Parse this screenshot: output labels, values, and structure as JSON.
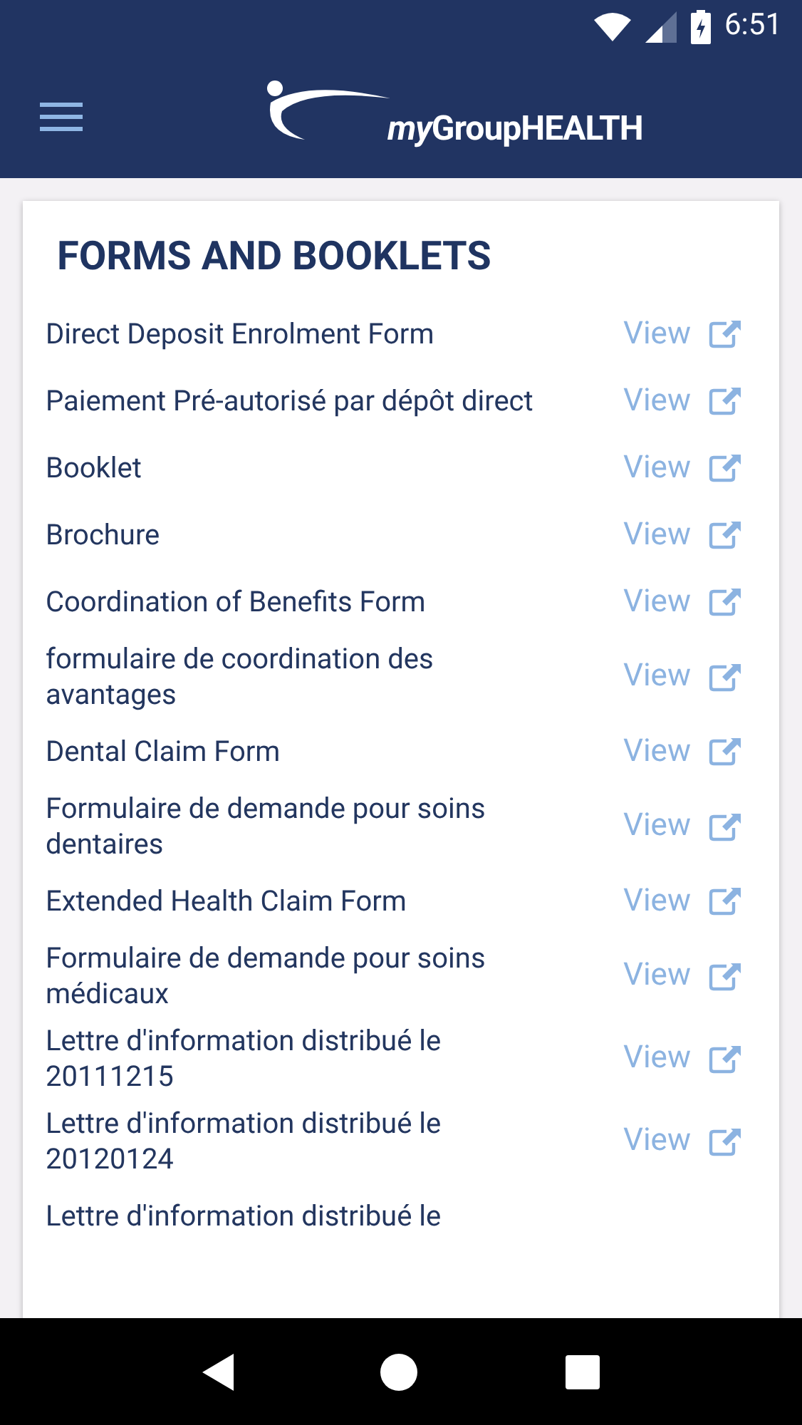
{
  "status_bar": {
    "time": "6:51"
  },
  "app_bar": {
    "logo_prefix": "my",
    "logo_name": "GroupHEALTH"
  },
  "section": {
    "title": "FORMS AND BOOKLETS",
    "items": [
      {
        "title": "Direct Deposit Enrolment Form",
        "link": "View"
      },
      {
        "title": "Paiement Pré-autorisé par dépôt direct",
        "link": "View"
      },
      {
        "title": "Booklet",
        "link": "View"
      },
      {
        "title": "Brochure",
        "link": "View"
      },
      {
        "title": "Coordination of Benefits Form",
        "link": "View"
      },
      {
        "title": "formulaire de coordination des avantages",
        "link": "View"
      },
      {
        "title": "Dental Claim Form",
        "link": "View"
      },
      {
        "title": "Formulaire de demande pour soins dentaires",
        "link": "View"
      },
      {
        "title": "Extended Health Claim Form",
        "link": "View"
      },
      {
        "title": "Formulaire de demande pour soins médicaux",
        "link": "View"
      },
      {
        "title": "Lettre d'information distribué le 20111215",
        "link": "View"
      },
      {
        "title": "Lettre d'information distribué le 20120124",
        "link": "View"
      },
      {
        "title": "Lettre d'information distribué le"
      }
    ]
  }
}
